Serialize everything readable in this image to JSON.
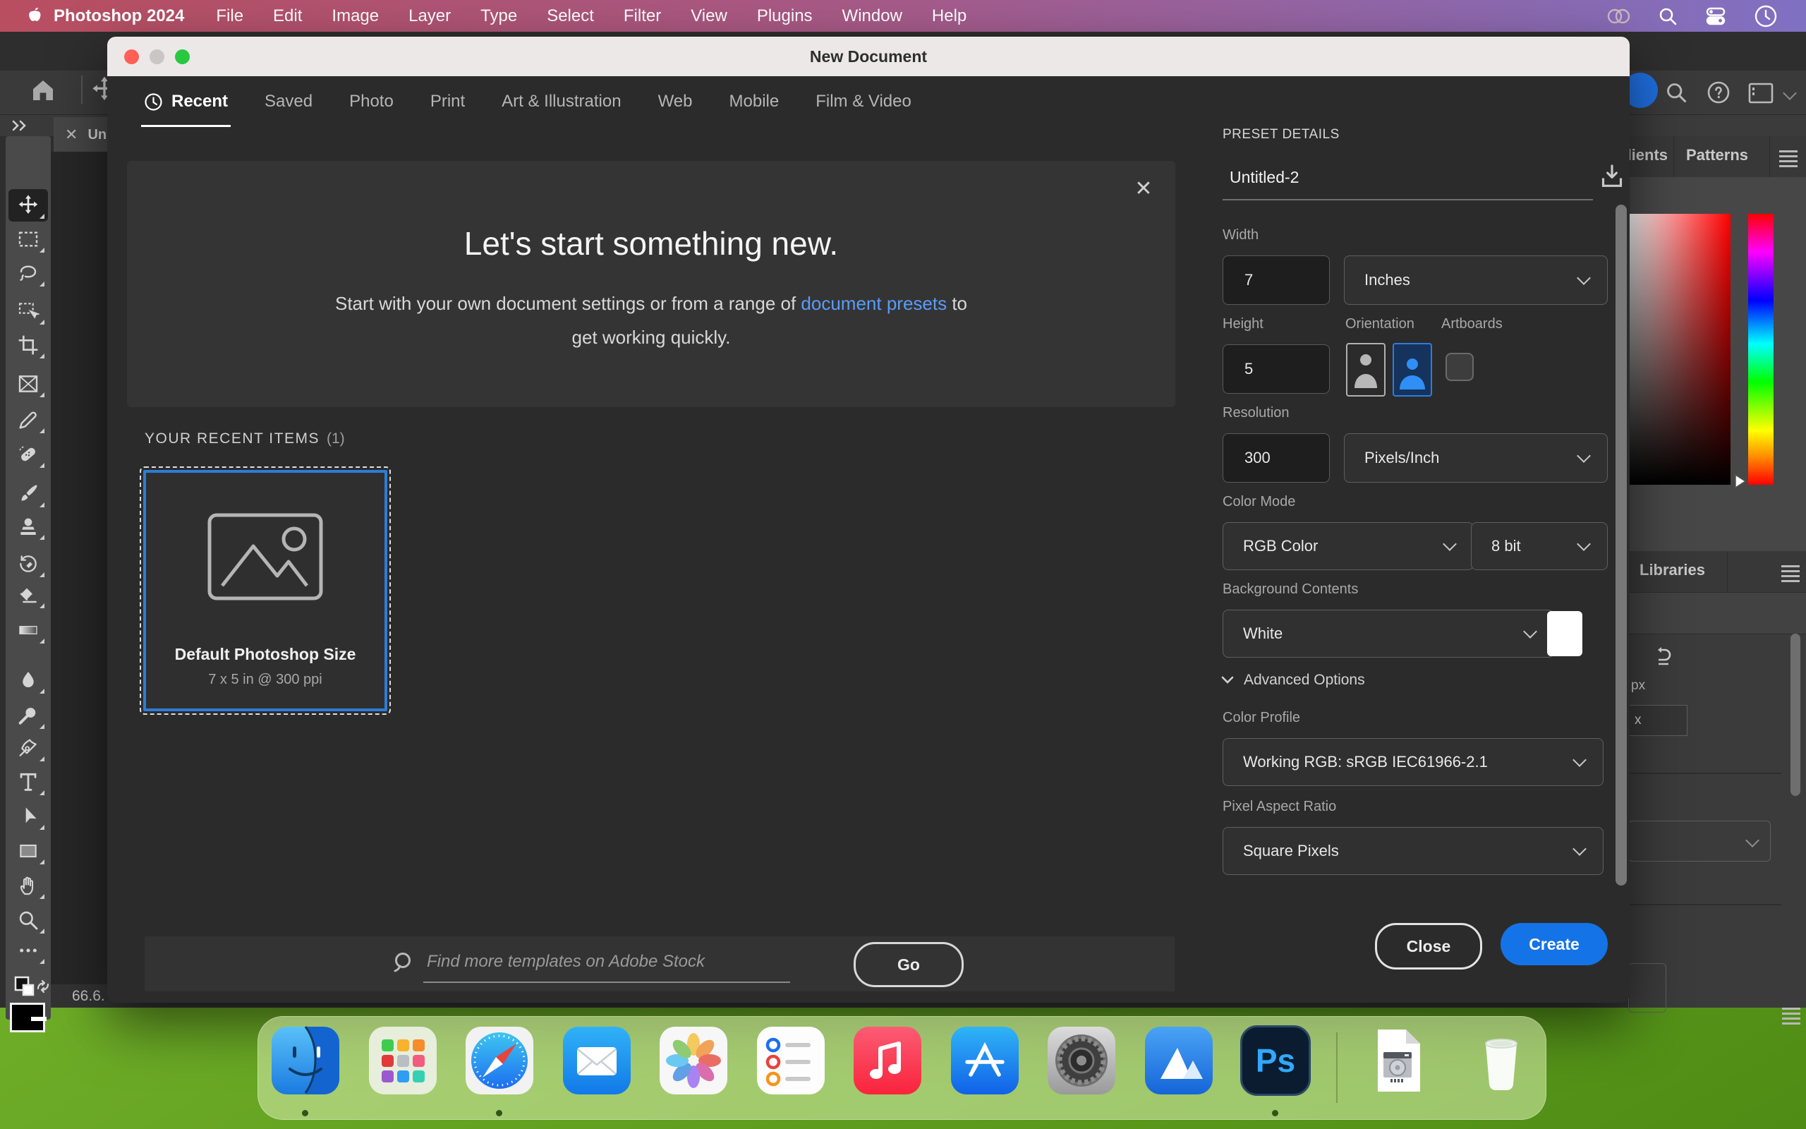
{
  "menubar": {
    "app_name": "Photoshop 2024",
    "items": [
      "File",
      "Edit",
      "Image",
      "Layer",
      "Type",
      "Select",
      "Filter",
      "View",
      "Plugins",
      "Window",
      "Help"
    ],
    "right_icons": [
      "creative-cloud-icon",
      "search-icon",
      "control-center-icon",
      "clock-icon"
    ]
  },
  "dialog": {
    "title": "New Document",
    "tabs": [
      "Recent",
      "Saved",
      "Photo",
      "Print",
      "Art & Illustration",
      "Web",
      "Mobile",
      "Film & Video"
    ],
    "active_tab": "Recent",
    "hero": {
      "heading": "Let's start something new.",
      "body_prefix": "Start with your own document settings or from a range of ",
      "link_text": "document presets",
      "body_suffix": " to",
      "body_line2": "get working quickly."
    },
    "recent": {
      "label": "YOUR RECENT ITEMS",
      "count": "(1)",
      "card": {
        "title": "Default Photoshop Size",
        "subtitle": "7 x 5 in @ 300 ppi"
      }
    },
    "search": {
      "placeholder": "Find more templates on Adobe Stock",
      "go_label": "Go"
    },
    "preset": {
      "header": "PRESET DETAILS",
      "name": "Untitled-2",
      "width_label": "Width",
      "width_value": "7",
      "width_unit": "Inches",
      "height_label": "Height",
      "height_value": "5",
      "orientation_label": "Orientation",
      "artboards_label": "Artboards",
      "resolution_label": "Resolution",
      "resolution_value": "300",
      "resolution_unit": "Pixels/Inch",
      "color_mode_label": "Color Mode",
      "color_mode": "RGB Color",
      "bit_depth": "8 bit",
      "background_label": "Background Contents",
      "background": "White",
      "advanced_label": "Advanced Options",
      "color_profile_label": "Color Profile",
      "color_profile": "Working RGB: sRGB IEC61966-2.1",
      "par_label": "Pixel Aspect Ratio",
      "par": "Square Pixels",
      "close_label": "Close",
      "create_label": "Create"
    }
  },
  "window": {
    "document_tab": "Un",
    "zoom_level": "66.6",
    "panel_tabs": {
      "gradients": "Gradients",
      "patterns": "Patterns",
      "libraries": "Libraries"
    },
    "px_label": "px",
    "partial_value": "x"
  },
  "tools": [
    "move",
    "rectangular-marquee",
    "lasso",
    "object-selection",
    "crop",
    "frame",
    "eyedropper",
    "spot-healing",
    "brush",
    "clone-stamp",
    "history-brush",
    "eraser",
    "gradient",
    "blur",
    "dodge",
    "pen",
    "type",
    "path-selection",
    "rectangle",
    "hand",
    "zoom",
    "edit-toolbar"
  ],
  "dock": {
    "apps": [
      "finder",
      "launchpad",
      "safari",
      "mail",
      "photos",
      "reminders",
      "music",
      "app-store",
      "system-settings",
      "mountain-peaks",
      "photoshop",
      "hard-drive-document",
      "trash"
    ],
    "running": [
      "finder",
      "safari",
      "photoshop"
    ],
    "ps_label": "Ps"
  },
  "colors": {
    "accent_blue": "#1473e6",
    "selection_blue": "#2e7cd6",
    "link_blue": "#5a9cf8",
    "menu_gradient_start": "#b94e60",
    "menu_gradient_end": "#8070c2",
    "desktop_green": "#6fae28",
    "dock_green": "#cde7a0",
    "white_swatch": "#ffffff"
  }
}
